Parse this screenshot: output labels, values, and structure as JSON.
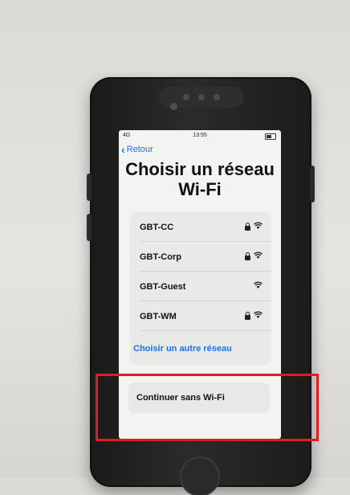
{
  "status_bar": {
    "signal": "4G",
    "time": "13:55"
  },
  "nav": {
    "back_label": "Retour"
  },
  "page": {
    "title_line1": "Choisir un réseau",
    "title_line2": "Wi-Fi"
  },
  "networks": [
    {
      "name": "GBT-CC",
      "locked": true
    },
    {
      "name": "GBT-Corp",
      "locked": true
    },
    {
      "name": "GBT-Guest",
      "locked": false
    },
    {
      "name": "GBT-WM",
      "locked": true
    }
  ],
  "other_network_label": "Choisir un autre réseau",
  "continue_label": "Continuer sans Wi-Fi",
  "colors": {
    "link": "#1a73e8",
    "highlight": "#e31b23"
  },
  "icons": {
    "back": "chevron-left-icon",
    "lock": "lock-icon",
    "wifi": "wifi-icon"
  }
}
